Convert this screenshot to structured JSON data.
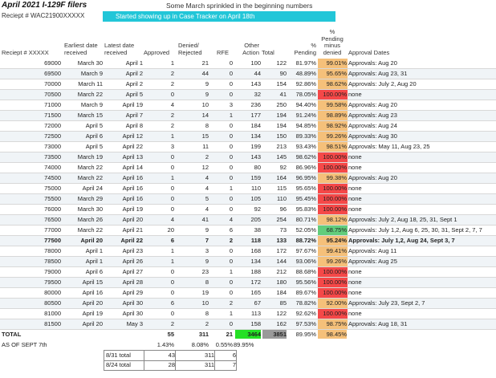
{
  "header": {
    "title": "April 2021 I-129F filers",
    "note": "Some March sprinkled in the beginning numbers",
    "receipt_label": "Reciept # WAC21900XXXXX",
    "cyan_note": "Started showing up in Case Tracker on April 18th"
  },
  "columns": {
    "receipt": "Reciept # XXXXX",
    "earliest": "Earliest date received",
    "latest": "Latest date received",
    "approved": "Approved",
    "denied": "Denied/ Rejected",
    "rfe": "RFE",
    "other": "Other Action",
    "total": "Total",
    "pending_pct": "% Pending",
    "pending_minus_denied": "% Pending minus denied",
    "approval_dates": "Approval Dates"
  },
  "colors": {
    "red": "#f54848",
    "orange": "#f5c07a",
    "green": "#62cd7c",
    "bright_green": "#25e025",
    "cyan": "#22c6d8"
  },
  "rows": [
    {
      "receipt": "69000",
      "earliest": "March 30",
      "latest": "April 1",
      "approved": "1",
      "denied": "21",
      "rfe": "0",
      "other": "100",
      "total": "122",
      "pct": "81.97%",
      "pmd": "99.01%",
      "color": "orange",
      "dates": "Approvals: Aug 20"
    },
    {
      "receipt": "69500",
      "earliest": "March 9",
      "latest": "April 2",
      "approved": "2",
      "denied": "44",
      "rfe": "0",
      "other": "44",
      "total": "90",
      "pct": "48.89%",
      "pmd": "95.65%",
      "color": "orange",
      "dates": "Approvals: Aug 23, 31"
    },
    {
      "receipt": "70000",
      "earliest": "March 11",
      "latest": "April 2",
      "approved": "2",
      "denied": "9",
      "rfe": "0",
      "other": "143",
      "total": "154",
      "pct": "92.86%",
      "pmd": "98.62%",
      "color": "orange",
      "dates": "Approvals: July 2, Aug 20"
    },
    {
      "receipt": "70500",
      "earliest": "March 22",
      "latest": "April 5",
      "approved": "0",
      "denied": "9",
      "rfe": "0",
      "other": "32",
      "total": "41",
      "pct": "78.05%",
      "pmd": "100.00%",
      "color": "red",
      "dates": "none"
    },
    {
      "receipt": "71000",
      "earliest": "March 9",
      "latest": "April 19",
      "approved": "4",
      "denied": "10",
      "rfe": "3",
      "other": "236",
      "total": "250",
      "pct": "94.40%",
      "pmd": "99.58%",
      "color": "orange",
      "dates": "Approvals: Aug 20"
    },
    {
      "receipt": "71500",
      "earliest": "March 15",
      "latest": "April 7",
      "approved": "2",
      "denied": "14",
      "rfe": "1",
      "other": "177",
      "total": "194",
      "pct": "91.24%",
      "pmd": "98.89%",
      "color": "orange",
      "dates": "Approvals: Aug 23"
    },
    {
      "receipt": "72000",
      "earliest": "April 5",
      "latest": "April 8",
      "approved": "2",
      "denied": "8",
      "rfe": "0",
      "other": "184",
      "total": "194",
      "pct": "94.85%",
      "pmd": "98.92%",
      "color": "orange",
      "dates": "Approvals: Aug 24"
    },
    {
      "receipt": "72500",
      "earliest": "April 6",
      "latest": "April 12",
      "approved": "1",
      "denied": "15",
      "rfe": "0",
      "other": "134",
      "total": "150",
      "pct": "89.33%",
      "pmd": "99.26%",
      "color": "orange",
      "dates": "Approvals: Aug 30"
    },
    {
      "receipt": "73000",
      "earliest": "April 5",
      "latest": "April 22",
      "approved": "3",
      "denied": "11",
      "rfe": "0",
      "other": "199",
      "total": "213",
      "pct": "93.43%",
      "pmd": "98.51%",
      "color": "orange",
      "dates": "Approvals: May 11, Aug 23, 25"
    },
    {
      "receipt": "73500",
      "earliest": "March 19",
      "latest": "April 13",
      "approved": "0",
      "denied": "2",
      "rfe": "0",
      "other": "143",
      "total": "145",
      "pct": "98.62%",
      "pmd": "100.00%",
      "color": "red",
      "dates": "none"
    },
    {
      "receipt": "74000",
      "earliest": "March 22",
      "latest": "April 14",
      "approved": "0",
      "denied": "12",
      "rfe": "0",
      "other": "80",
      "total": "92",
      "pct": "86.96%",
      "pmd": "100.00%",
      "color": "red",
      "dates": "none"
    },
    {
      "receipt": "74500",
      "earliest": "March 22",
      "latest": "April 16",
      "approved": "1",
      "denied": "4",
      "rfe": "0",
      "other": "159",
      "total": "164",
      "pct": "96.95%",
      "pmd": "99.38%",
      "color": "orange",
      "dates": "Approvals: Aug 20"
    },
    {
      "receipt": "75000",
      "earliest": "April 24",
      "latest": "April 16",
      "approved": "0",
      "denied": "4",
      "rfe": "1",
      "other": "110",
      "total": "115",
      "pct": "95.65%",
      "pmd": "100.00%",
      "color": "red",
      "dates": "none"
    },
    {
      "receipt": "75500",
      "earliest": "March 29",
      "latest": "April 16",
      "approved": "0",
      "denied": "5",
      "rfe": "0",
      "other": "105",
      "total": "110",
      "pct": "95.45%",
      "pmd": "100.00%",
      "color": "red",
      "dates": "none"
    },
    {
      "receipt": "76000",
      "earliest": "March 30",
      "latest": "April 19",
      "approved": "0",
      "denied": "4",
      "rfe": "0",
      "other": "92",
      "total": "96",
      "pct": "95.83%",
      "pmd": "100.00%",
      "color": "red",
      "dates": "none"
    },
    {
      "receipt": "76500",
      "earliest": "March 26",
      "latest": "April 20",
      "approved": "4",
      "denied": "41",
      "rfe": "4",
      "other": "205",
      "total": "254",
      "pct": "80.71%",
      "pmd": "98.12%",
      "color": "orange",
      "dates": "Approvals: July 2, Aug 18, 25, 31, Sept 1"
    },
    {
      "receipt": "77000",
      "earliest": "March 22",
      "latest": "April 21",
      "approved": "20",
      "denied": "9",
      "rfe": "6",
      "other": "38",
      "total": "73",
      "pct": "52.05%",
      "pmd": "68.75%",
      "color": "green",
      "dates": "Approvals: July 1,2, Aug 6, 25, 30, 31, Sept 2, 7, 7"
    },
    {
      "receipt": "77500",
      "earliest": "April 20",
      "latest": "April 22",
      "approved": "6",
      "denied": "7",
      "rfe": "2",
      "other": "118",
      "total": "133",
      "pct": "88.72%",
      "pmd": "95.24%",
      "color": "orange",
      "dates": "Approvals: July 1,2, Aug 24, Sept 3, 7",
      "bold": true
    },
    {
      "receipt": "78000",
      "earliest": "April 1",
      "latest": "April 23",
      "approved": "1",
      "denied": "3",
      "rfe": "0",
      "other": "168",
      "total": "172",
      "pct": "97.67%",
      "pmd": "99.41%",
      "color": "orange",
      "dates": "Approvals: Aug 11"
    },
    {
      "receipt": "78500",
      "earliest": "April 1",
      "latest": "April 26",
      "approved": "1",
      "denied": "9",
      "rfe": "0",
      "other": "134",
      "total": "144",
      "pct": "93.06%",
      "pmd": "99.26%",
      "color": "orange",
      "dates": "Approvals: Aug 25"
    },
    {
      "receipt": "79000",
      "earliest": "April 6",
      "latest": "April 27",
      "approved": "0",
      "denied": "23",
      "rfe": "1",
      "other": "188",
      "total": "212",
      "pct": "88.68%",
      "pmd": "100.00%",
      "color": "red",
      "dates": "none"
    },
    {
      "receipt": "79500",
      "earliest": "April 15",
      "latest": "April 28",
      "approved": "0",
      "denied": "8",
      "rfe": "0",
      "other": "172",
      "total": "180",
      "pct": "95.56%",
      "pmd": "100.00%",
      "color": "red",
      "dates": "none"
    },
    {
      "receipt": "80000",
      "earliest": "April 16",
      "latest": "April 29",
      "approved": "0",
      "denied": "19",
      "rfe": "0",
      "other": "165",
      "total": "184",
      "pct": "89.67%",
      "pmd": "100.00%",
      "color": "red",
      "dates": "none"
    },
    {
      "receipt": "80500",
      "earliest": "April 20",
      "latest": "April 30",
      "approved": "6",
      "denied": "10",
      "rfe": "2",
      "other": "67",
      "total": "85",
      "pct": "78.82%",
      "pmd": "92.00%",
      "color": "orange",
      "dates": "Approvals: July 23, Sept 2, 7"
    },
    {
      "receipt": "81000",
      "earliest": "April 19",
      "latest": "April 30",
      "approved": "0",
      "denied": "8",
      "rfe": "1",
      "other": "113",
      "total": "122",
      "pct": "92.62%",
      "pmd": "100.00%",
      "color": "red",
      "dates": "none"
    },
    {
      "receipt": "81500",
      "earliest": "April 20",
      "latest": "May 3",
      "approved": "2",
      "denied": "2",
      "rfe": "0",
      "other": "158",
      "total": "162",
      "pct": "97.53%",
      "pmd": "98.75%",
      "color": "orange",
      "dates": "Approvals: Aug 18, 31"
    }
  ],
  "totals": {
    "label": "TOTAL",
    "approved": "55",
    "denied": "311",
    "rfe": "21",
    "other": "3464",
    "total": "3851",
    "pct": "89.95%",
    "pmd": "98.45%"
  },
  "as_of": {
    "label": "AS OF SEPT 7th",
    "approved_pct": "1.43%",
    "denied_pct": "8.08%",
    "rfe_pct": "0.55%",
    "other_pct": "89.95%"
  },
  "small_table": [
    {
      "label": "8/31 total",
      "a": "43",
      "b": "311",
      "c": "6"
    },
    {
      "label": "8/24 total",
      "a": "28",
      "b": "311",
      "c": "7"
    }
  ]
}
